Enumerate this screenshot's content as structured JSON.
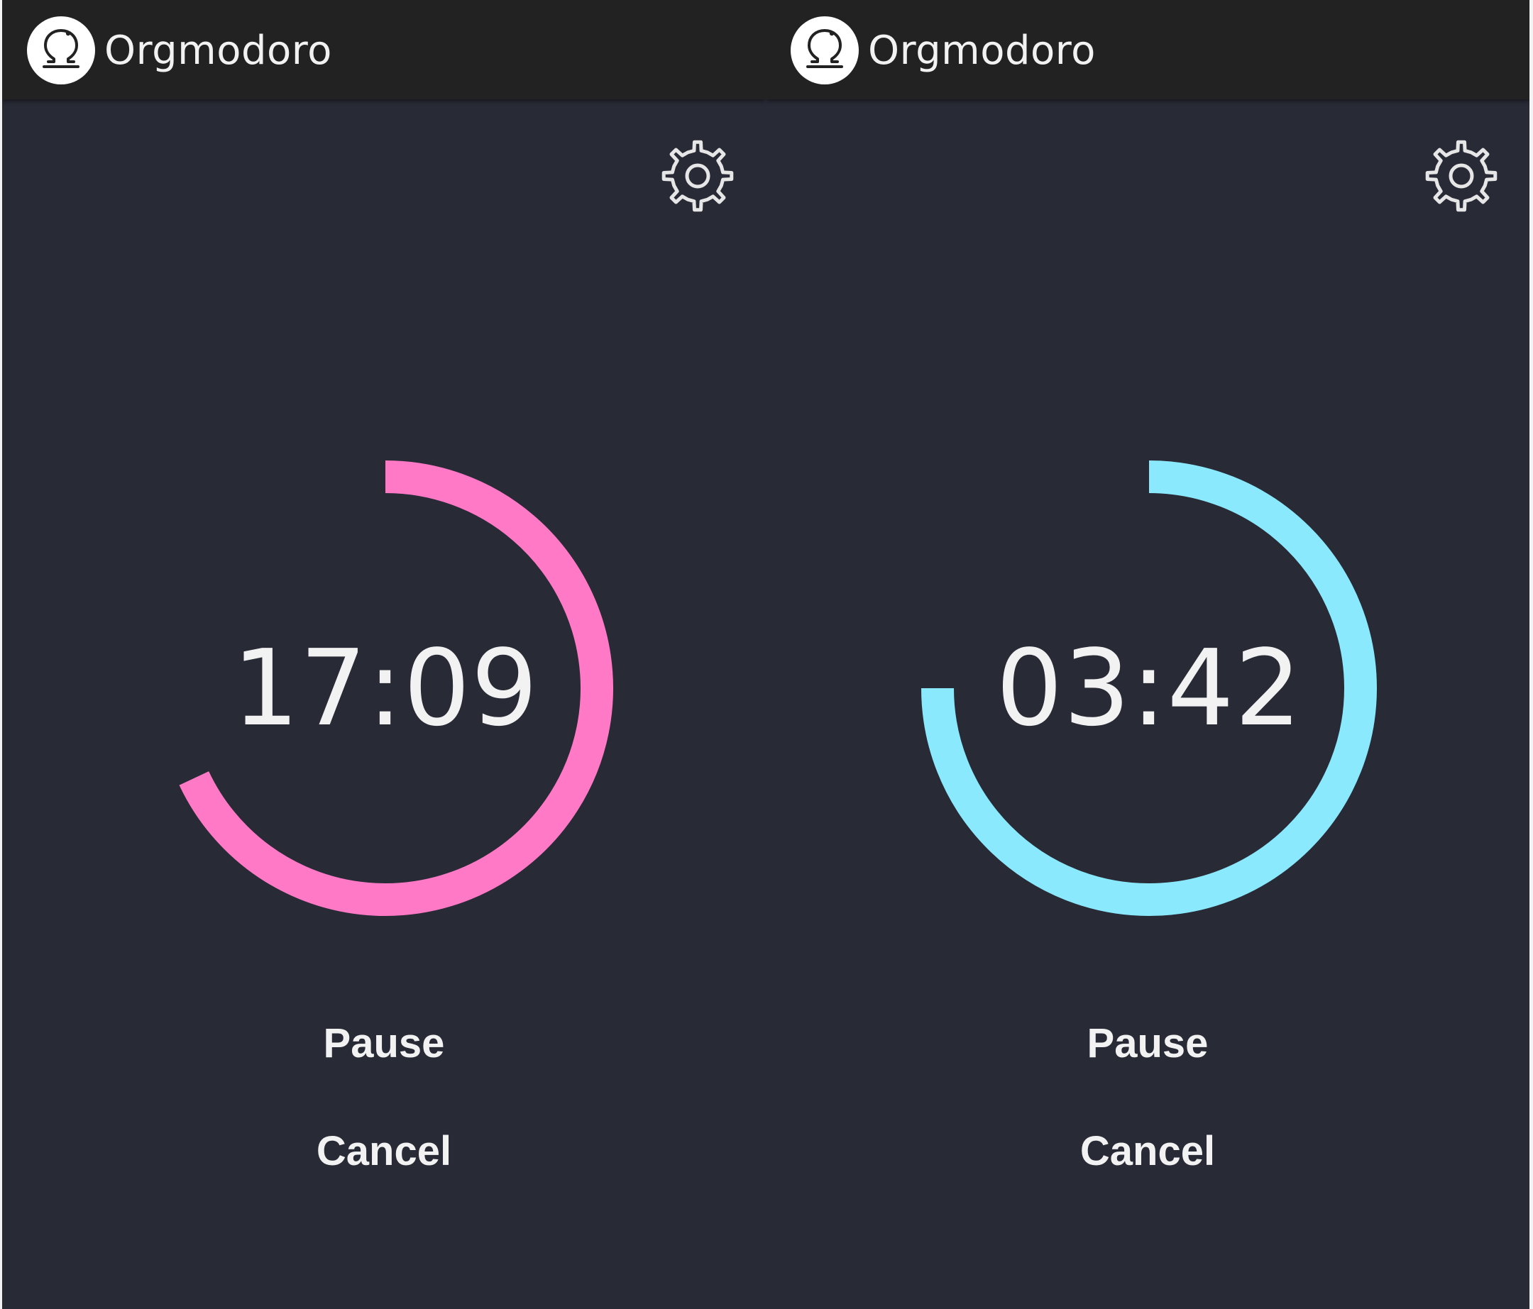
{
  "colors": {
    "background": "#282a36",
    "appbar": "#222222",
    "text": "#f2f2f2",
    "pink_accent": "#ff79c6",
    "cyan_accent": "#8be9fd"
  },
  "screens": [
    {
      "app_title": "Orgmodoro",
      "logo_icon": "omega-icon",
      "settings_icon": "gear-icon",
      "time": "17:09",
      "progress_fraction": 0.68,
      "ring_color": "#ff79c6",
      "pause_label": "Pause",
      "cancel_label": "Cancel"
    },
    {
      "app_title": "Orgmodoro",
      "logo_icon": "omega-icon",
      "settings_icon": "gear-icon",
      "time": "03:42",
      "progress_fraction": 0.75,
      "ring_color": "#8be9fd",
      "pause_label": "Pause",
      "cancel_label": "Cancel"
    }
  ]
}
